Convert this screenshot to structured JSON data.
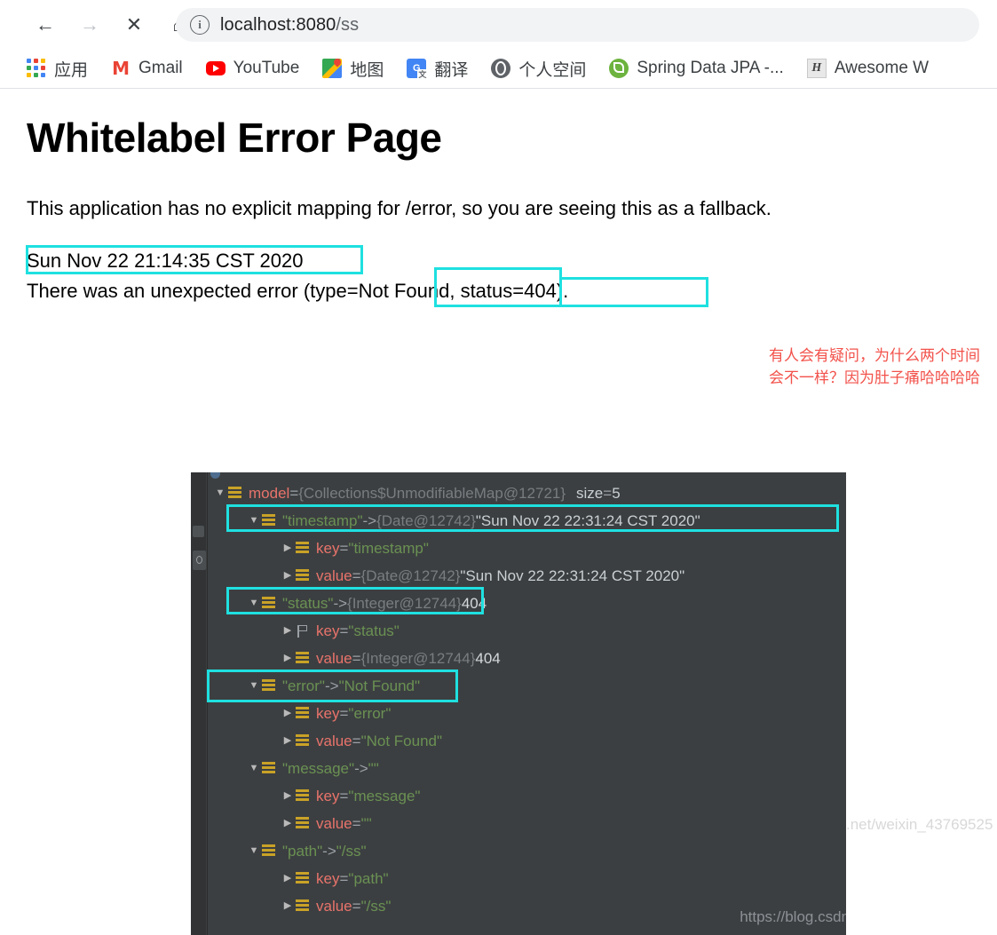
{
  "browser": {
    "nav": {
      "back_icon": "arrow-left-icon",
      "forward_icon": "arrow-right-icon",
      "stop_icon": "close-icon",
      "home_icon": "home-icon"
    },
    "omnibox": {
      "info_icon": "info-icon",
      "info_glyph": "i",
      "url_host": "localhost:8080",
      "url_path": "/ss"
    },
    "bookmarks": [
      {
        "label": "应用",
        "icon": "apps-grid-icon"
      },
      {
        "label": "Gmail",
        "icon": "gmail-icon",
        "glyph": "M"
      },
      {
        "label": "YouTube",
        "icon": "youtube-icon"
      },
      {
        "label": "地图",
        "icon": "google-maps-icon"
      },
      {
        "label": "翻译",
        "icon": "google-translate-icon"
      },
      {
        "label": "个人空间",
        "icon": "globe-icon"
      },
      {
        "label": "Spring Data JPA -...",
        "icon": "spring-leaf-icon"
      },
      {
        "label": "Awesome W",
        "icon": "awesome-h-icon",
        "glyph": "H"
      }
    ],
    "apps_grid_colors": [
      "#4285f4",
      "#ea4335",
      "#fbbc04",
      "#34a853",
      "#4285f4",
      "#ea4335",
      "#fbbc04",
      "#34a853",
      "#4285f4"
    ]
  },
  "error_page": {
    "title": "Whitelabel Error Page",
    "description": "This application has no explicit mapping for /error, so you are seeing this as a fallback.",
    "timestamp": "Sun Nov 22 21:14:35 CST 2020",
    "error_line_prefix": "There was an unexpected error (type=",
    "error_type": "Not Found",
    "error_separator": ", ",
    "error_status": "status=404",
    "error_line_suffix": ")."
  },
  "annotation": {
    "color": "#1fe0e0",
    "note_color": "#f2524b",
    "note_text": "有人会有疑问，为什么两个时间会不一样？因为肚子痛哈哈哈哈"
  },
  "debugger": {
    "clipped_row": "ⓘ  ... ...",
    "rows": [
      {
        "indent": 0,
        "toggle": "down",
        "icon": "stack-icon",
        "name": "model",
        "eq": " = ",
        "ref": "{Collections$UnmodifiableMap@12721}",
        "suffix_label": "size",
        "suffix_eq": " = ",
        "suffix_value": "5",
        "highlight": false
      },
      {
        "indent": 1,
        "toggle": "down",
        "icon": "stack-icon",
        "str_key": "\"timestamp\"",
        "arrow": " -> ",
        "ref": "{Date@12742}",
        "white_value": "\"Sun Nov 22 22:31:24 CST 2020\"",
        "highlight": true
      },
      {
        "indent": 2,
        "toggle": "right",
        "icon": "stack-icon",
        "name": "key",
        "eq": " = ",
        "str_value": "\"timestamp\"",
        "highlight": false
      },
      {
        "indent": 2,
        "toggle": "right",
        "icon": "stack-icon",
        "name": "value",
        "eq": " = ",
        "ref": "{Date@12742}",
        "white_value": "\"Sun Nov 22 22:31:24 CST 2020\"",
        "highlight": false
      },
      {
        "indent": 1,
        "toggle": "down",
        "icon": "stack-icon",
        "str_key": "\"status\"",
        "arrow": " -> ",
        "ref": "{Integer@12744}",
        "num_value": "404",
        "highlight": true
      },
      {
        "indent": 2,
        "toggle": "right",
        "icon": "flag-icon",
        "name": "key",
        "eq": " = ",
        "str_value": "\"status\"",
        "highlight": false
      },
      {
        "indent": 2,
        "toggle": "right",
        "icon": "stack-icon",
        "name": "value",
        "eq": " = ",
        "ref": "{Integer@12744}",
        "num_value": "404",
        "highlight": false
      },
      {
        "indent": 1,
        "toggle": "down",
        "icon": "stack-icon",
        "str_key": "\"error\"",
        "arrow": " -> ",
        "str_value2": "\"Not Found\"",
        "highlight": true
      },
      {
        "indent": 2,
        "toggle": "right",
        "icon": "stack-icon",
        "name": "key",
        "eq": " = ",
        "str_value": "\"error\"",
        "highlight": false
      },
      {
        "indent": 2,
        "toggle": "right",
        "icon": "stack-icon",
        "name": "value",
        "eq": " = ",
        "str_value": "\"Not Found\"",
        "highlight": false
      },
      {
        "indent": 1,
        "toggle": "down",
        "icon": "stack-icon",
        "str_key": "\"message\"",
        "arrow": " -> ",
        "str_value2": "\"\"",
        "highlight": false
      },
      {
        "indent": 2,
        "toggle": "right",
        "icon": "stack-icon",
        "name": "key",
        "eq": " = ",
        "str_value": "\"message\"",
        "highlight": false
      },
      {
        "indent": 2,
        "toggle": "right",
        "icon": "stack-icon",
        "name": "value",
        "eq": " = ",
        "str_value": "\"\"",
        "highlight": false
      },
      {
        "indent": 1,
        "toggle": "down",
        "icon": "stack-icon",
        "str_key": "\"path\"",
        "arrow": " -> ",
        "str_value2": "\"/ss\"",
        "highlight": false
      },
      {
        "indent": 2,
        "toggle": "right",
        "icon": "stack-icon",
        "name": "key",
        "eq": " = ",
        "str_value": "\"path\"",
        "highlight": false
      },
      {
        "indent": 2,
        "toggle": "right",
        "icon": "stack-icon",
        "name": "value",
        "eq": " = ",
        "str_value": "\"/ss\"",
        "highlight": false
      }
    ],
    "watermark_inside": "https://blog.csdn",
    "watermark_outside": ".net/weixin_43769525"
  }
}
